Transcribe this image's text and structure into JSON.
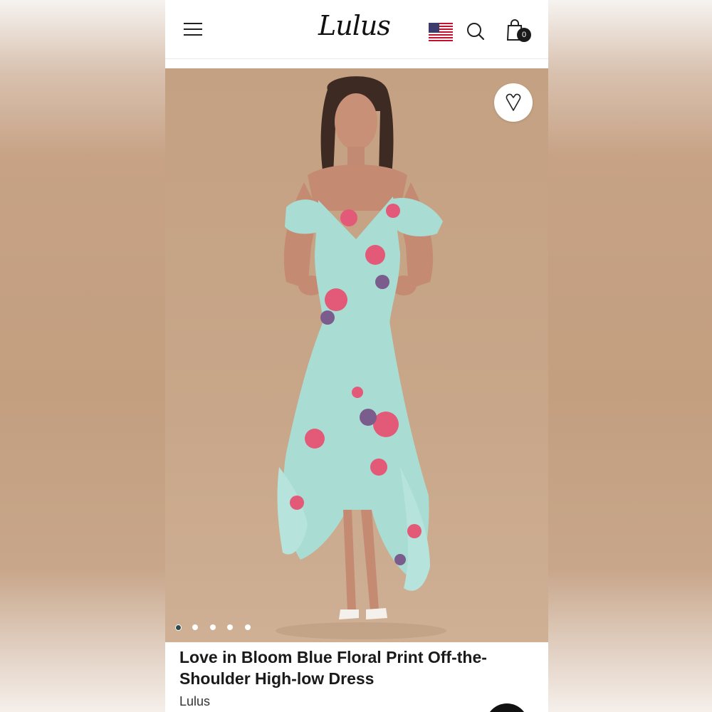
{
  "header": {
    "logo_text": "Lulus",
    "cart_count": "0",
    "icons": [
      "menu-icon",
      "us-flag-icon",
      "search-icon",
      "shopping-bag-icon"
    ]
  },
  "hero": {
    "image_alt": "Model wearing mint floral off-the-shoulder high-low dress",
    "favorite_icon": "heart-icon",
    "carousel": {
      "total": 5,
      "active_index": 0
    }
  },
  "product": {
    "title": "Love in Bloom Blue Floral Print Off-the-Shoulder High-low Dress",
    "brand": "Lulus"
  },
  "colors": {
    "backdrop": "#c4a182",
    "dress_mint": "#a9ddd4",
    "floral_pink": "#e35a78",
    "floral_purple": "#7a5d8c",
    "active_dot": "#2b4b4e"
  }
}
